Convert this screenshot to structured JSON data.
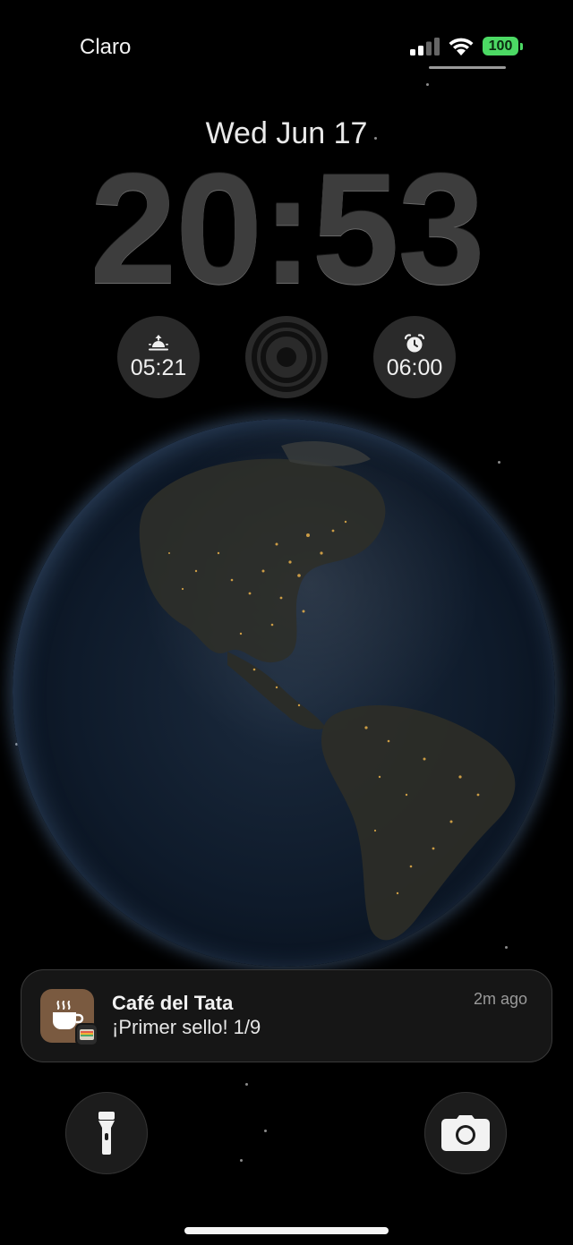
{
  "status_bar": {
    "carrier": "Claro",
    "battery_level": "100",
    "signal_icon": "cellular-signal-icon",
    "wifi_icon": "wifi-icon",
    "battery_color": "#4cd964"
  },
  "lock_screen": {
    "date": "Wed Jun 17",
    "time": "20:53"
  },
  "widgets": {
    "sunrise": {
      "icon": "sunrise-icon",
      "time": "05:21"
    },
    "focus": {
      "icon": "focus-rings-icon"
    },
    "alarm": {
      "icon": "alarm-clock-icon",
      "time": "06:00"
    }
  },
  "notification": {
    "app_icon": "coffee-cup-icon",
    "badge_icon": "wallet-icon",
    "title": "Café del Tata",
    "body": "¡Primer sello! 1/9",
    "time": "2m ago",
    "app_color": "#7a5a40"
  },
  "quick_actions": {
    "flashlight_icon": "flashlight-icon",
    "camera_icon": "camera-icon"
  },
  "wallpaper": {
    "subject": "earth-at-night",
    "atmosphere_color": "#78aae6"
  }
}
